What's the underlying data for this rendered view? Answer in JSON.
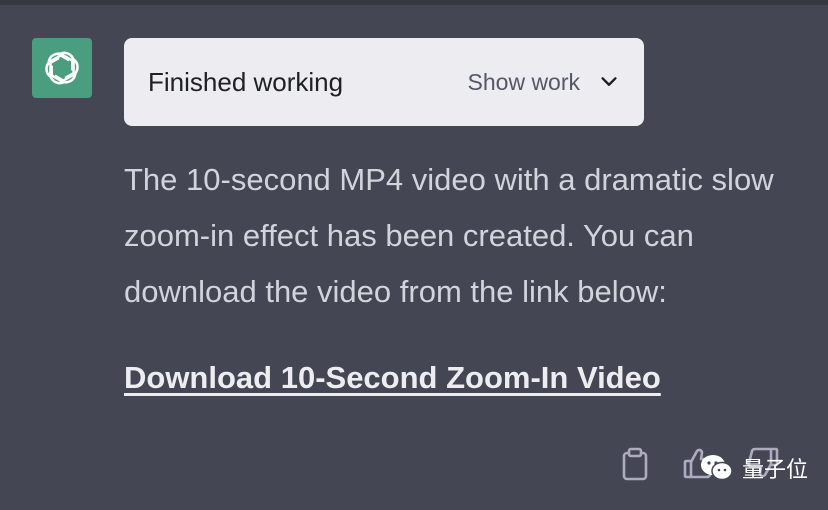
{
  "assistant": {
    "avatar_icon": "openai-logo-icon",
    "avatar_color": "#4a9d7f"
  },
  "status_card": {
    "title": "Finished working",
    "toggle_label": "Show work",
    "toggle_icon": "chevron-down-icon"
  },
  "message": {
    "text": "The 10-second MP4 video with a dramatic slow zoom-in effect has been created. You can download the video from the link below:",
    "link_text": "Download 10-Second Zoom-In Video"
  },
  "actions": {
    "copy_icon": "clipboard-icon",
    "like_icon": "thumbs-up-icon",
    "dislike_icon": "thumbs-down-icon"
  },
  "watermark": {
    "text": "量子位",
    "icon": "wechat-icon"
  },
  "colors": {
    "background": "#444654",
    "card": "#ececf1",
    "text": "#d1d5db"
  }
}
